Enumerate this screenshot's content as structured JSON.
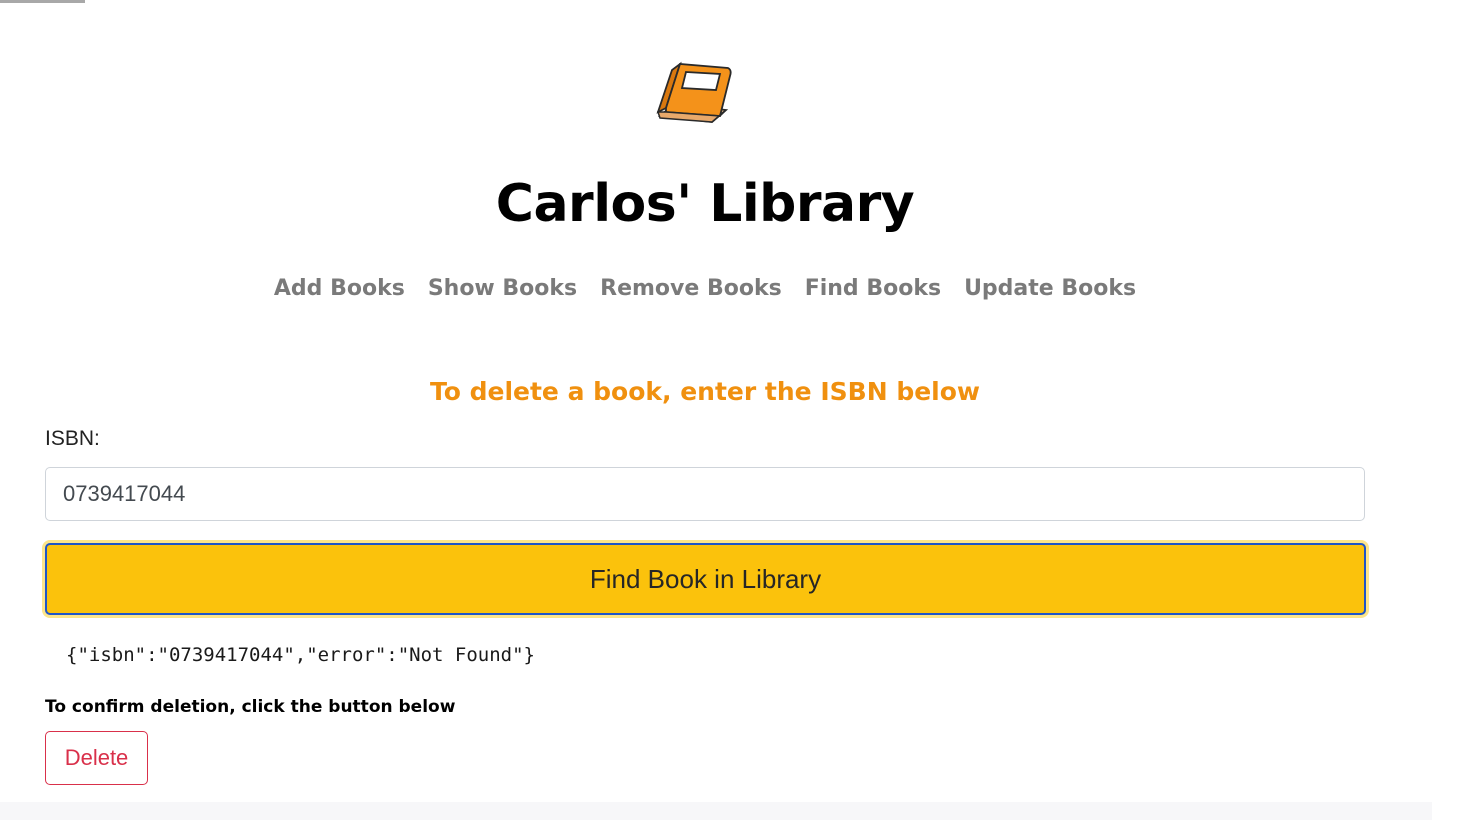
{
  "header": {
    "logo_icon": "book-icon",
    "title": "Carlos' Library"
  },
  "nav": {
    "items": [
      {
        "label": "Add Books"
      },
      {
        "label": "Show Books"
      },
      {
        "label": "Remove Books"
      },
      {
        "label": "Find Books"
      },
      {
        "label": "Update Books"
      }
    ]
  },
  "form": {
    "heading": "To delete a book, enter the ISBN below",
    "isbn_label": "ISBN:",
    "isbn_value": "0739417044",
    "find_button_label": "Find Book in Library"
  },
  "result": {
    "text": "{\"isbn\":\"0739417044\",\"error\":\"Not Found\"}"
  },
  "confirm": {
    "text": "To confirm deletion, click the button below",
    "delete_button_label": "Delete"
  },
  "colors": {
    "accent_orange": "#f0900f",
    "button_yellow": "#fbc20c",
    "focus_blue": "#1f55c7",
    "danger_red": "#d9304a",
    "nav_gray": "#7a7a7a"
  }
}
